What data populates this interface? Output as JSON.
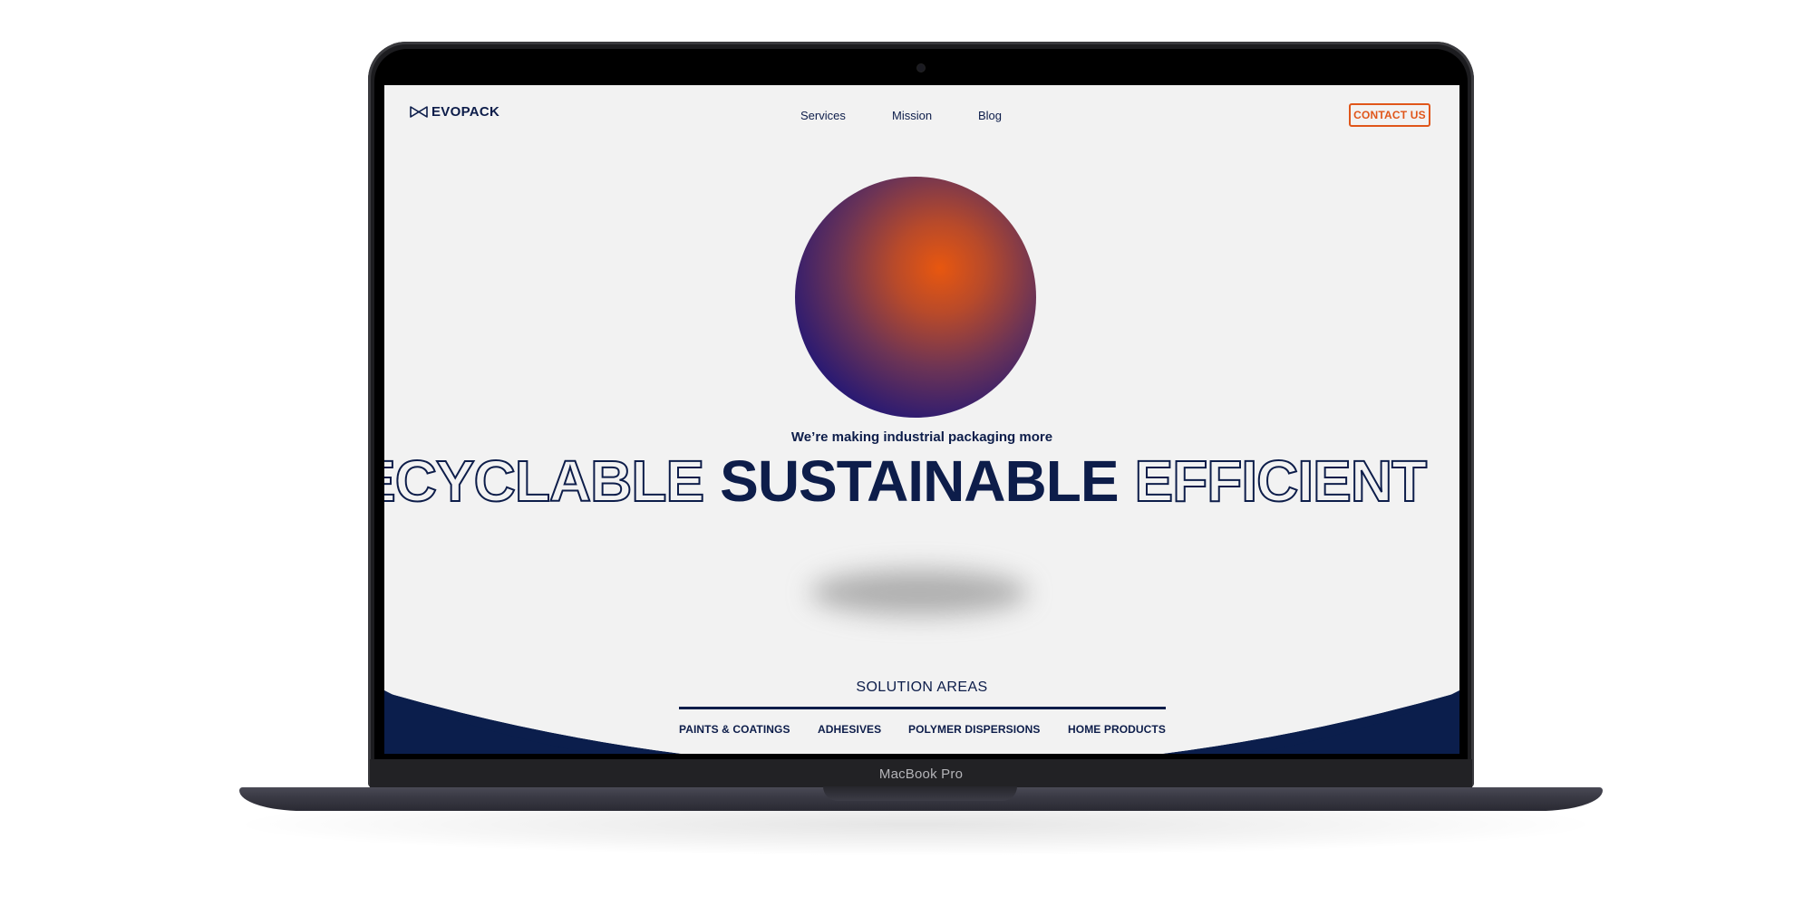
{
  "device": {
    "label": "MacBook Pro"
  },
  "nav": {
    "logo_text": "EVOPACK",
    "links": [
      "Services",
      "Mission",
      "Blog"
    ],
    "cta": "CONTACT US"
  },
  "hero": {
    "tagline": "We’re making industrial packaging more",
    "words": [
      "ECYCLABLE",
      "SUSTAINABLE",
      "EFFICIENT"
    ],
    "active_word": "SUSTAINABLE"
  },
  "solutions": {
    "title": "SOLUTION AREAS",
    "tabs": [
      "PAINTS & COATINGS",
      "ADHESIVES",
      "POLYMER DISPERSIONS",
      "HOME PRODUCTS"
    ]
  },
  "colors": {
    "brand_navy": "#0d1d4a",
    "accent_orange": "#e0561a",
    "page_bg": "#f2f2f2"
  }
}
